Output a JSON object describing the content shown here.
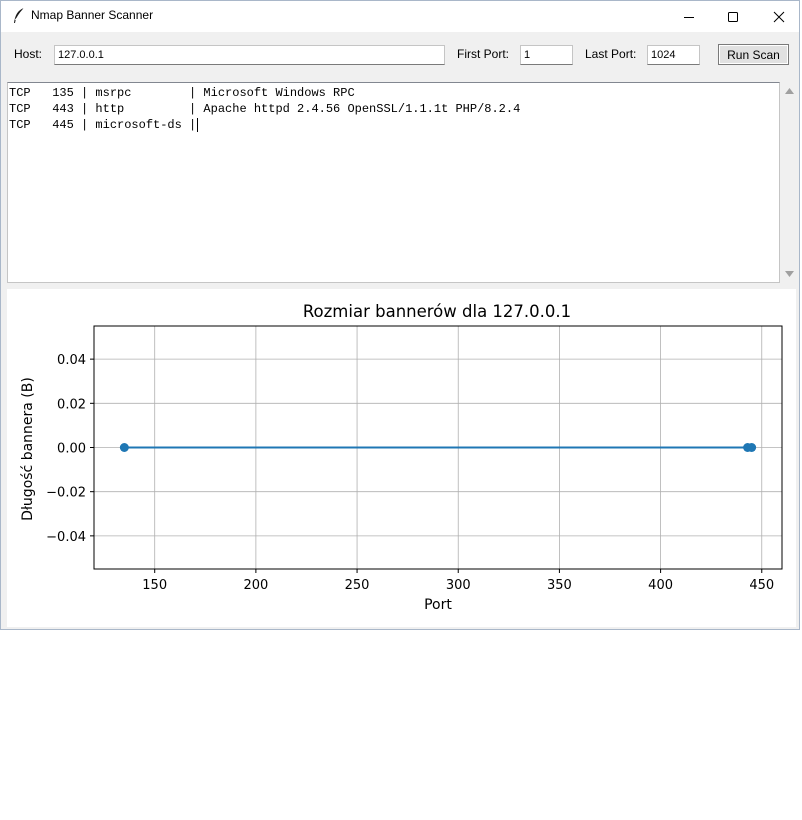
{
  "window": {
    "title": "Nmap Banner Scanner",
    "controls": [
      "minimize",
      "maximize",
      "close"
    ]
  },
  "toolbar": {
    "host_label": "Host:",
    "host_value": "127.0.0.1",
    "first_port_label": "First Port:",
    "first_port_value": "1",
    "last_port_label": "Last Port:",
    "last_port_value": "1024",
    "run_button": "Run Scan"
  },
  "output": {
    "lines": [
      "TCP   135 | msrpc        | Microsoft Windows RPC",
      "TCP   443 | http         | Apache httpd 2.4.56 OpenSSL/1.1.1t PHP/8.2.4",
      "TCP   445 | microsoft-ds |"
    ]
  },
  "colors": {
    "series": "#1f77b4",
    "grid": "#b0b0b0",
    "window_bg": "#f0f0f0"
  },
  "chart_data": {
    "type": "line",
    "title": "Rozmiar bannerów dla 127.0.0.1",
    "xlabel": "Port",
    "ylabel": "Długość bannera (B)",
    "x": [
      135,
      443,
      445
    ],
    "series": [
      {
        "values": [
          0,
          0,
          0
        ]
      }
    ],
    "xlim": [
      120,
      460
    ],
    "ylim": [
      -0.055,
      0.055
    ],
    "xticks": [
      150,
      200,
      250,
      300,
      350,
      400,
      450
    ],
    "xtick_labels": [
      "150",
      "200",
      "250",
      "300",
      "350",
      "400",
      "450"
    ],
    "yticks": [
      0.04,
      0.02,
      0.0,
      -0.02,
      -0.04
    ],
    "ytick_labels": [
      "0.04",
      "0.02",
      "0.00",
      "−0.02",
      "−0.04"
    ],
    "grid": true,
    "marker": "circle"
  }
}
